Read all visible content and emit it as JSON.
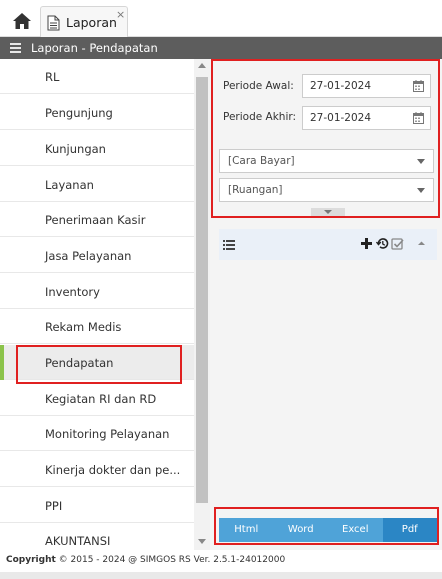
{
  "tab": {
    "label": "Laporan",
    "close": "×"
  },
  "header": {
    "title": "Laporan - Pendapatan"
  },
  "sidebar": {
    "items": [
      {
        "label": "RL"
      },
      {
        "label": "Pengunjung"
      },
      {
        "label": "Kunjungan"
      },
      {
        "label": "Layanan"
      },
      {
        "label": "Penerimaan Kasir"
      },
      {
        "label": "Jasa Pelayanan"
      },
      {
        "label": "Inventory"
      },
      {
        "label": "Rekam Medis"
      },
      {
        "label": "Pendapatan"
      },
      {
        "label": "Kegiatan RI dan RD"
      },
      {
        "label": "Monitoring Pelayanan"
      },
      {
        "label": "Kinerja dokter dan pe..."
      },
      {
        "label": "PPI"
      },
      {
        "label": "AKUNTANSI"
      }
    ],
    "active_label": "Pendapatan"
  },
  "filters": {
    "periode_awal_label": "Periode Awal:",
    "periode_awal_value": "27-01-2024",
    "periode_akhir_label": "Periode Akhir:",
    "periode_akhir_value": "27-01-2024",
    "cara_bayar_value": "[Cara Bayar]",
    "ruangan_value": "[Ruangan]"
  },
  "export": {
    "html": "Html",
    "word": "Word",
    "excel": "Excel",
    "pdf": "Pdf"
  },
  "footer": {
    "copyright_label": "Copyright",
    "copyright_symbol": "©",
    "text": "2015 - 2024 @ SIMGOS RS Ver. 2.5.1-24012000"
  },
  "colors": {
    "header_bg": "#5d5d5d",
    "active_marker": "#8bc34a",
    "export_btn": "#4fa3d8",
    "export_btn_selected": "#2b86c5",
    "annotation": "#e02020"
  }
}
